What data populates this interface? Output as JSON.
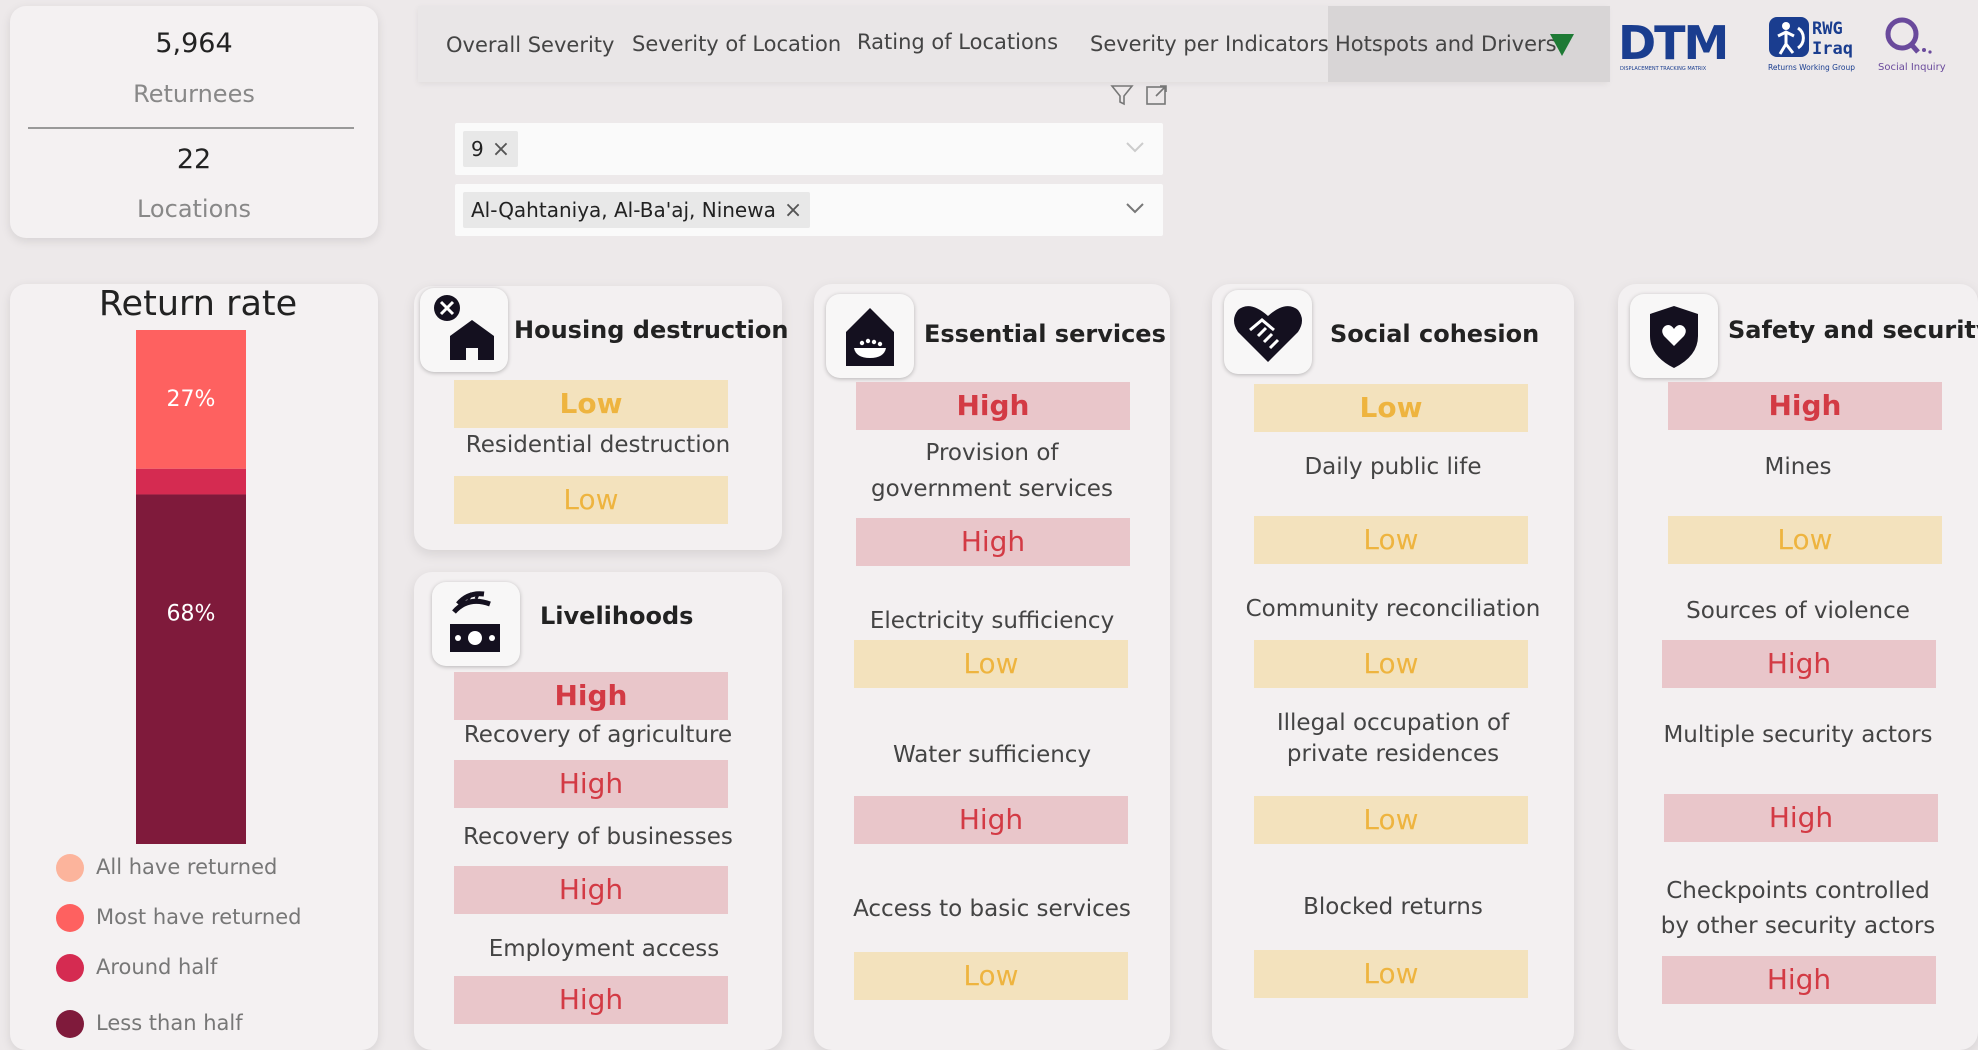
{
  "stats": {
    "returnees_value": "5,964",
    "returnees_label": "Returnees",
    "locations_value": "22",
    "locations_label": "Locations"
  },
  "tabs": [
    "Overall Severity",
    "Severity of Location",
    "Rating of Locations",
    "Severity per Indicators",
    "Hotspots and Drivers"
  ],
  "logos": {
    "dtm": "DTM",
    "dtm_sub": "DISPLACEMENT TRACKING MATRIX",
    "rwg_line1": "RWG",
    "rwg_line2": "Iraq",
    "rwg_sub": "Returns Working Group",
    "si_sub": "Social Inquiry"
  },
  "filters": {
    "slicer1_value": "9",
    "slicer2_value": "Al-Qahtaniya, Al-Ba'aj, Ninewa"
  },
  "return_rate": {
    "title": "Return rate",
    "segments": [
      {
        "name": "Most have returned",
        "percent": 27,
        "label": "27%",
        "color": "#fe6160"
      },
      {
        "name": "Around half",
        "percent": 5,
        "label": "",
        "color": "#d52b51"
      },
      {
        "name": "Less than half",
        "percent": 68,
        "label": "68%",
        "color": "#7f1a3b"
      }
    ],
    "legend": [
      {
        "label": "All have returned",
        "color": "#fcb49c"
      },
      {
        "label": "Most have returned",
        "color": "#fe6160"
      },
      {
        "label": "Around half",
        "color": "#d52b51"
      },
      {
        "label": "Less than half",
        "color": "#7f1a3b"
      }
    ]
  },
  "colors": {
    "high_bg": "#e9c6ca",
    "high_text": "#d33a44",
    "low_bg": "#f3e2bd",
    "low_text": "#eeb43f"
  },
  "cards": {
    "housing": {
      "title": "Housing destruction",
      "icon": "house-destroyed-icon",
      "overall": "Low",
      "items": [
        {
          "label": "Residential destruction",
          "value": "Low"
        }
      ]
    },
    "livelihoods": {
      "title": "Livelihoods",
      "icon": "money-wheat-icon",
      "overall": "High",
      "items": [
        {
          "label": "Recovery of agriculture",
          "value": "High"
        },
        {
          "label": "Recovery of businesses",
          "value": "High"
        },
        {
          "label": "Employment access",
          "value": "High"
        }
      ]
    },
    "essential": {
      "title": "Essential services",
      "icon": "house-services-icon",
      "overall": "High",
      "items": [
        {
          "label_l1": "Provision of",
          "label_l2": "government services",
          "value": "High"
        },
        {
          "label": "Electricity sufficiency",
          "value": "Low"
        },
        {
          "label": "Water sufficiency",
          "value": "High"
        },
        {
          "label": "Access to basic services",
          "value": "Low"
        }
      ]
    },
    "social": {
      "title": "Social cohesion",
      "icon": "handshake-heart-icon",
      "overall": "Low",
      "items": [
        {
          "label": "Daily public life",
          "value": "Low"
        },
        {
          "label": "Community reconciliation",
          "value": "Low"
        },
        {
          "label_l1": "Illegal occupation of",
          "label_l2": "private residences",
          "value": "Low"
        },
        {
          "label": "Blocked returns",
          "value": "Low"
        }
      ]
    },
    "safety": {
      "title": "Safety and security",
      "icon": "shield-heart-icon",
      "overall": "High",
      "items": [
        {
          "label": "Mines",
          "value": "Low"
        },
        {
          "label": "Sources of violence",
          "value": "High"
        },
        {
          "label": "Multiple security actors",
          "value": "High"
        },
        {
          "label_l1": "Checkpoints controlled",
          "label_l2": "by other security actors",
          "value": "High"
        }
      ]
    }
  }
}
